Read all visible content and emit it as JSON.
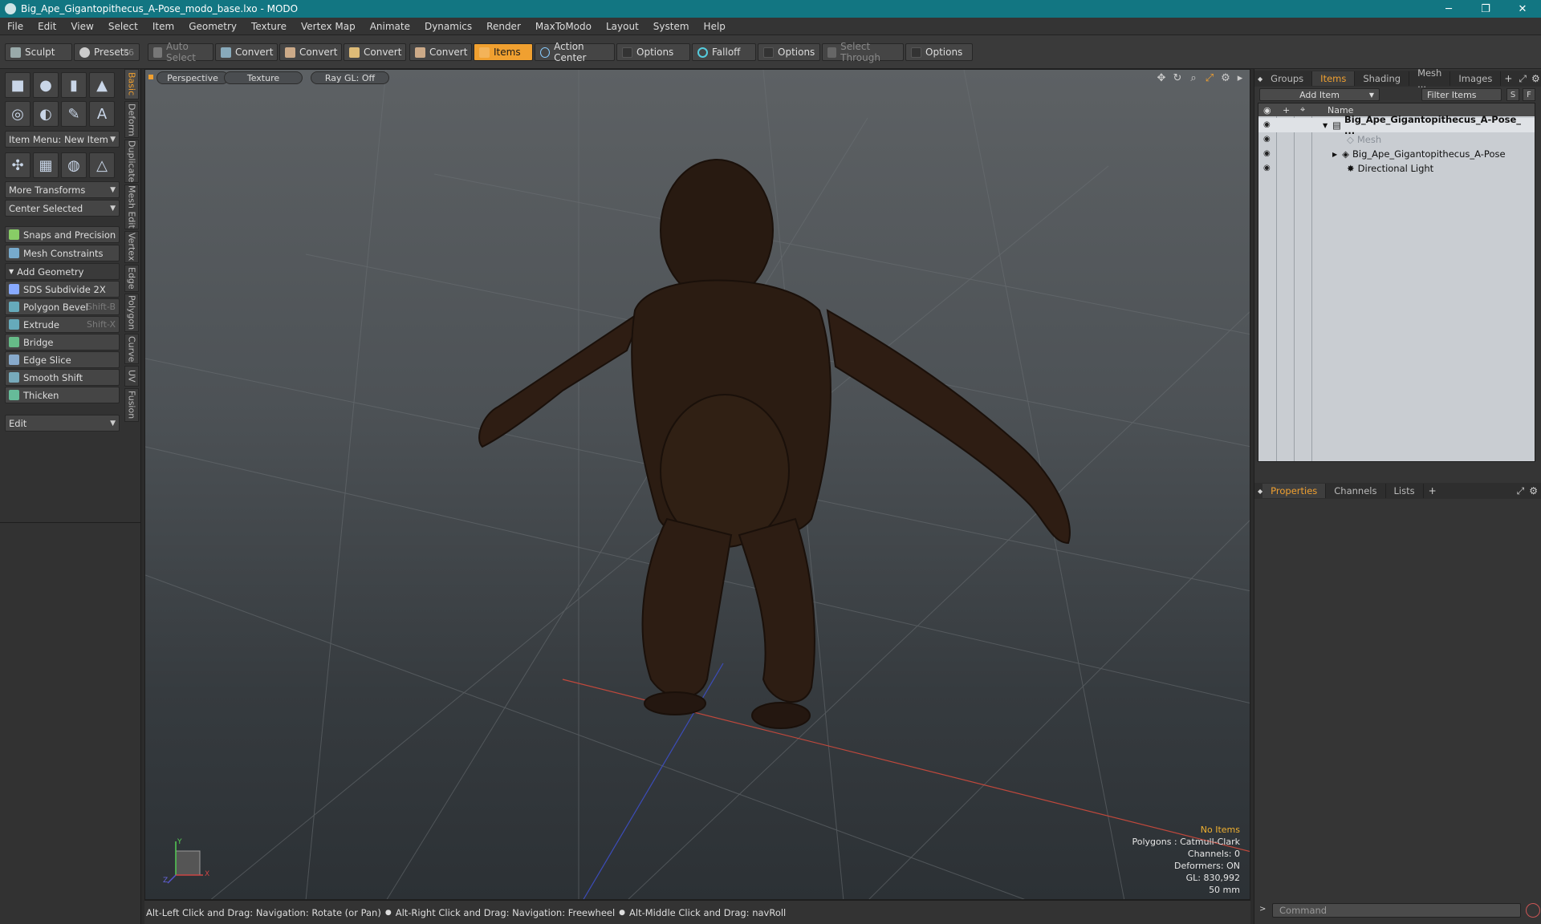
{
  "window": {
    "title": "Big_Ape_Gigantopithecus_A-Pose_modo_base.lxo - MODO",
    "minimize": "─",
    "maximize": "❐",
    "close": "✕"
  },
  "menu": [
    "File",
    "Edit",
    "View",
    "Select",
    "Item",
    "Geometry",
    "Texture",
    "Vertex Map",
    "Animate",
    "Dynamics",
    "Render",
    "MaxToModo",
    "Layout",
    "System",
    "Help"
  ],
  "toolbar": {
    "sculpt": "Sculpt",
    "presets": "Presets",
    "presets_shortcut": "F6",
    "auto_select": "Auto Select",
    "convert1": "Convert",
    "convert2": "Convert",
    "convert3": "Convert",
    "convert4": "Convert",
    "items": "Items",
    "action_center": "Action Center",
    "options1": "Options",
    "falloff": "Falloff",
    "options2": "Options",
    "select_through": "Select Through",
    "options3": "Options"
  },
  "left": {
    "item_menu": "Item Menu: New Item",
    "more_transforms": "More Transforms",
    "center_selected": "Center Selected",
    "snaps": "Snaps and Precision",
    "mesh_constraints": "Mesh Constraints",
    "add_geometry": "Add Geometry",
    "tools": [
      {
        "label": "SDS Subdivide 2X",
        "shortcut": ""
      },
      {
        "label": "Polygon Bevel",
        "shortcut": "Shift-B"
      },
      {
        "label": "Extrude",
        "shortcut": "Shift-X"
      },
      {
        "label": "Bridge",
        "shortcut": ""
      },
      {
        "label": "Edge Slice",
        "shortcut": ""
      },
      {
        "label": "Smooth Shift",
        "shortcut": ""
      },
      {
        "label": "Thicken",
        "shortcut": ""
      }
    ],
    "edit": "Edit",
    "vtabs": [
      "Basic",
      "Deform",
      "Duplicate",
      "Mesh Edit",
      "Vertex",
      "Edge",
      "Polygon",
      "Curve",
      "UV",
      "Fusion"
    ]
  },
  "viewport": {
    "tabs": [
      "Perspective",
      "Texture",
      "Ray GL: Off"
    ],
    "hud": {
      "no_items": "No Items",
      "polygons": "Polygons : Catmull-Clark",
      "channels": "Channels: 0",
      "deformers": "Deformers: ON",
      "gl": "GL: 830,992",
      "lens": "50 mm"
    },
    "axis": {
      "y": "Y",
      "x": "X",
      "z": "Z"
    }
  },
  "status": [
    "Alt-Left Click and Drag: Navigation: Rotate (or Pan)",
    "Alt-Right Click and Drag: Navigation: Freewheel",
    "Alt-Middle Click and Drag: navRoll"
  ],
  "right": {
    "tabs": [
      "Groups",
      "Items",
      "Shading",
      "Mesh ...",
      "Images"
    ],
    "add_item": "Add Item",
    "filter_items": "Filter Items",
    "filter_s": "S",
    "filter_f": "F",
    "name_header": "Name",
    "items": [
      {
        "label": "Big_Ape_Gigantopithecus_A-Pose_ ..."
      },
      {
        "label": "Mesh"
      },
      {
        "label": "Big_Ape_Gigantopithecus_A-Pose"
      },
      {
        "label": "Directional Light"
      }
    ],
    "prop_tabs": [
      "Properties",
      "Channels",
      "Lists"
    ],
    "command_placeholder": "Command"
  },
  "colors": {
    "accent": "#f0a030",
    "titlebar": "#127682"
  }
}
